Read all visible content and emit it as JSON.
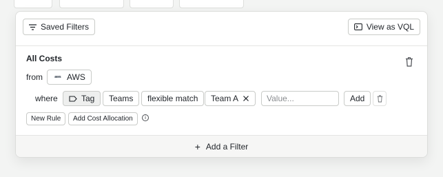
{
  "toolbar": {
    "saved_filters_label": "Saved Filters",
    "view_as_vql_label": "View as VQL"
  },
  "rule": {
    "title": "All Costs",
    "from_label": "from",
    "provider": "AWS",
    "provider_logo_text": "aws",
    "where_label": "where",
    "tag_label": "Tag",
    "tag_key": "Teams",
    "match_type": "flexible match",
    "selected_value": "Team A",
    "value_placeholder": "Value...",
    "add_label": "Add"
  },
  "actions": {
    "new_rule_label": "New Rule",
    "add_cost_allocation_label": "Add Cost Allocation",
    "info_glyph": "i"
  },
  "footer": {
    "add_filter_label": "Add a Filter",
    "add_glyph": "+"
  }
}
